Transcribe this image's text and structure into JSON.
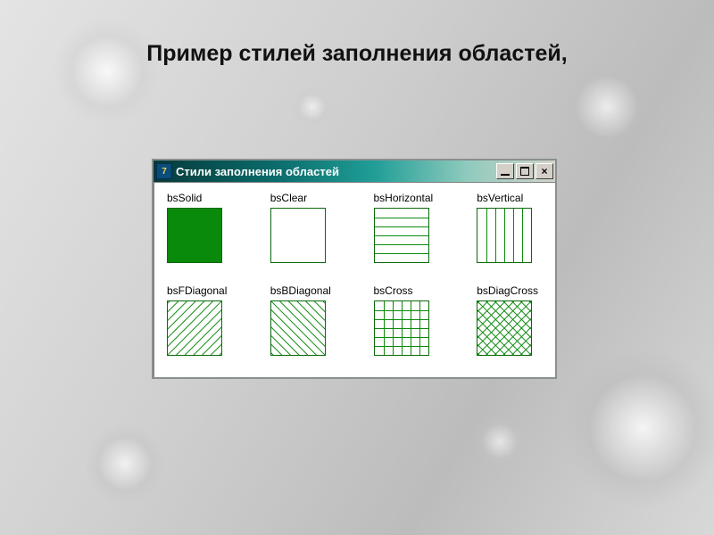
{
  "slide": {
    "title": "Пример стилей заполнения областей,"
  },
  "window": {
    "title": "Стили заполнения областей",
    "app_icon_text": "7",
    "buttons": {
      "min": "_",
      "max": "□",
      "close": "×"
    }
  },
  "styles": [
    {
      "key": "bsSolid",
      "label": "bsSolid"
    },
    {
      "key": "bsClear",
      "label": "bsClear"
    },
    {
      "key": "bsHorizontal",
      "label": "bsHorizontal"
    },
    {
      "key": "bsVertical",
      "label": "bsVertical"
    },
    {
      "key": "bsFDiagonal",
      "label": "bsFDiagonal"
    },
    {
      "key": "bsBDiagonal",
      "label": "bsBDiagonal"
    },
    {
      "key": "bsCross",
      "label": "bsCross"
    },
    {
      "key": "bsDiagCross",
      "label": "bsDiagCross"
    }
  ],
  "colors": {
    "brush": "#0a8a0a"
  }
}
